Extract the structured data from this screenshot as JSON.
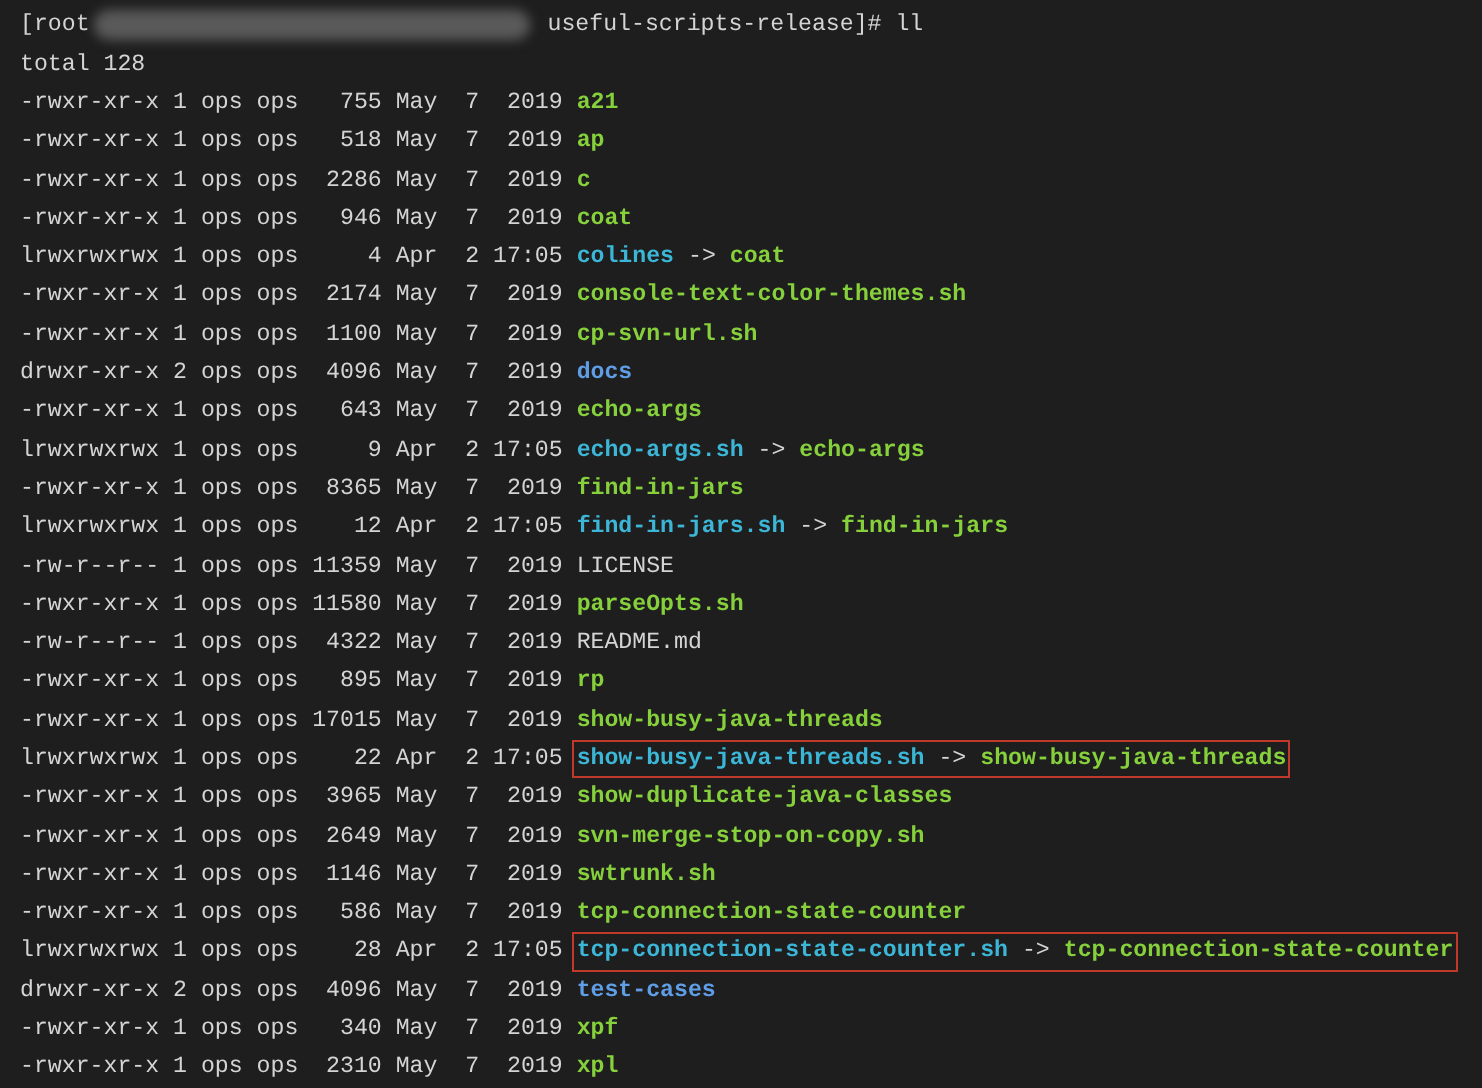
{
  "prompt": {
    "prefix": "[root",
    "suffix": "useful-scripts-release]# ll"
  },
  "total": "total 128",
  "entries": [
    {
      "meta": "-rwxr-xr-x 1 ops ops   755 May  7  2019",
      "name": "a21",
      "kind": "exec",
      "highlighted": false
    },
    {
      "meta": "-rwxr-xr-x 1 ops ops   518 May  7  2019",
      "name": "ap",
      "kind": "exec",
      "highlighted": false
    },
    {
      "meta": "-rwxr-xr-x 1 ops ops  2286 May  7  2019",
      "name": "c",
      "kind": "exec",
      "highlighted": false
    },
    {
      "meta": "-rwxr-xr-x 1 ops ops   946 May  7  2019",
      "name": "coat",
      "kind": "exec",
      "highlighted": false
    },
    {
      "meta": "lrwxrwxrwx 1 ops ops     4 Apr  2 17:05",
      "name": "colines",
      "kind": "link",
      "arrow": "->",
      "target": "coat",
      "highlighted": false
    },
    {
      "meta": "-rwxr-xr-x 1 ops ops  2174 May  7  2019",
      "name": "console-text-color-themes.sh",
      "kind": "exec",
      "highlighted": false
    },
    {
      "meta": "-rwxr-xr-x 1 ops ops  1100 May  7  2019",
      "name": "cp-svn-url.sh",
      "kind": "exec",
      "highlighted": false
    },
    {
      "meta": "drwxr-xr-x 2 ops ops  4096 May  7  2019",
      "name": "docs",
      "kind": "dir",
      "highlighted": false
    },
    {
      "meta": "-rwxr-xr-x 1 ops ops   643 May  7  2019",
      "name": "echo-args",
      "kind": "exec",
      "highlighted": false
    },
    {
      "meta": "lrwxrwxrwx 1 ops ops     9 Apr  2 17:05",
      "name": "echo-args.sh",
      "kind": "link",
      "arrow": "->",
      "target": "echo-args",
      "highlighted": false
    },
    {
      "meta": "-rwxr-xr-x 1 ops ops  8365 May  7  2019",
      "name": "find-in-jars",
      "kind": "exec",
      "highlighted": false
    },
    {
      "meta": "lrwxrwxrwx 1 ops ops    12 Apr  2 17:05",
      "name": "find-in-jars.sh",
      "kind": "link",
      "arrow": "->",
      "target": "find-in-jars",
      "highlighted": false
    },
    {
      "meta": "-rw-r--r-- 1 ops ops 11359 May  7  2019",
      "name": "LICENSE",
      "kind": "file",
      "highlighted": false
    },
    {
      "meta": "-rwxr-xr-x 1 ops ops 11580 May  7  2019",
      "name": "parseOpts.sh",
      "kind": "exec",
      "highlighted": false
    },
    {
      "meta": "-rw-r--r-- 1 ops ops  4322 May  7  2019",
      "name": "README.md",
      "kind": "file",
      "highlighted": false
    },
    {
      "meta": "-rwxr-xr-x 1 ops ops   895 May  7  2019",
      "name": "rp",
      "kind": "exec",
      "highlighted": false
    },
    {
      "meta": "-rwxr-xr-x 1 ops ops 17015 May  7  2019",
      "name": "show-busy-java-threads",
      "kind": "exec",
      "highlighted": false
    },
    {
      "meta": "lrwxrwxrwx 1 ops ops    22 Apr  2 17:05",
      "name": "show-busy-java-threads.sh",
      "kind": "link",
      "arrow": "->",
      "target": "show-busy-java-threads",
      "highlighted": true
    },
    {
      "meta": "-rwxr-xr-x 1 ops ops  3965 May  7  2019",
      "name": "show-duplicate-java-classes",
      "kind": "exec",
      "highlighted": false
    },
    {
      "meta": "-rwxr-xr-x 1 ops ops  2649 May  7  2019",
      "name": "svn-merge-stop-on-copy.sh",
      "kind": "exec",
      "highlighted": false
    },
    {
      "meta": "-rwxr-xr-x 1 ops ops  1146 May  7  2019",
      "name": "swtrunk.sh",
      "kind": "exec",
      "highlighted": false
    },
    {
      "meta": "-rwxr-xr-x 1 ops ops   586 May  7  2019",
      "name": "tcp-connection-state-counter",
      "kind": "exec",
      "highlighted": false
    },
    {
      "meta": "lrwxrwxrwx 1 ops ops    28 Apr  2 17:05",
      "name": "tcp-connection-state-counter.sh",
      "kind": "link",
      "arrow": "->",
      "target": "tcp-connection-state-counter",
      "highlighted": true
    },
    {
      "meta": "drwxr-xr-x 2 ops ops  4096 May  7  2019",
      "name": "test-cases",
      "kind": "dir",
      "highlighted": false
    },
    {
      "meta": "-rwxr-xr-x 1 ops ops   340 May  7  2019",
      "name": "xpf",
      "kind": "exec",
      "highlighted": false
    },
    {
      "meta": "-rwxr-xr-x 1 ops ops  2310 May  7  2019",
      "name": "xpl",
      "kind": "exec",
      "highlighted": false
    }
  ]
}
